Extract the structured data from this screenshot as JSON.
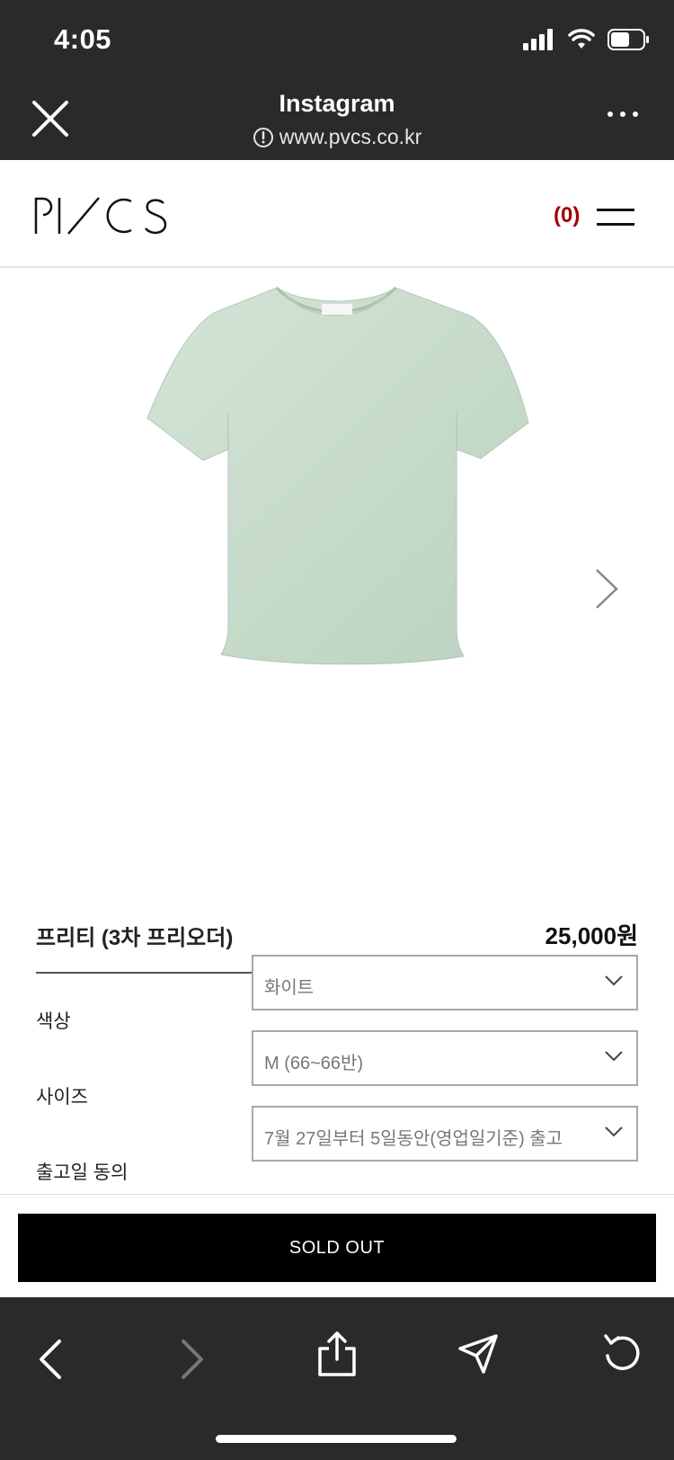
{
  "status_bar": {
    "time": "4:05"
  },
  "browser": {
    "title": "Instagram",
    "url": "www.pvcs.co.kr"
  },
  "site": {
    "logo_text": "PVCS",
    "cart_count": "(0)"
  },
  "product": {
    "name": "프리티 (3차 프리오더)",
    "price": "25,000원",
    "shirt_color": "#c9dccd"
  },
  "options": [
    {
      "label": "색상",
      "value": "화이트"
    },
    {
      "label": "사이즈",
      "value": "M (66~66반)"
    },
    {
      "label": "출고일 동의",
      "value": "7월 27일부터 5일동안(영업일기준) 출고"
    }
  ],
  "actions": {
    "sold_out_label": "SOLD OUT"
  },
  "colors": {
    "chrome": "#2a2a2a",
    "cart": "#a00000",
    "button": "#000000"
  }
}
